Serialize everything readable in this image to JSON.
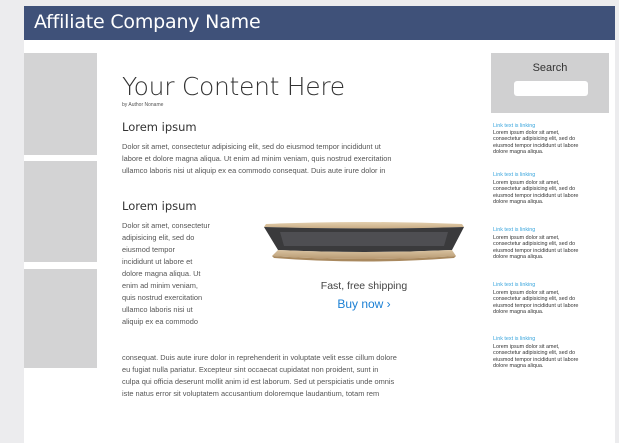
{
  "header": {
    "title": "Affiliate Company Name"
  },
  "article": {
    "title": "Your Content Here",
    "byline": "by Author Noname",
    "section1_heading": "Lorem ipsum",
    "section1_lines": [
      "Dolor sit amet, consectetur adipisicing elit, sed do eiusmod tempor incididunt ut",
      "labore et dolore magna aliqua. Ut enim ad minim veniam, quis nostrud exercitation",
      "ullamco laboris nisi ut aliquip ex ea commodo consequat. Duis aute irure dolor in"
    ],
    "section2_heading": "Lorem ipsum",
    "section2_narrow_lines": [
      "Dolor sit amet, consectetur",
      "adipisicing elit, sed do",
      "eiusmod tempor",
      "incididunt ut labore et",
      "dolore magna aliqua. Ut",
      "enim ad minim veniam,",
      "quis nostrud exercitation",
      "ullamco laboris nisi ut",
      "aliquip ex ea commodo"
    ],
    "section2_wide_lines": [
      "consequat. Duis aute irure dolor in reprehenderit in voluptate velit esse cillum dolore",
      "eu fugiat nulla pariatur. Excepteur sint occaecat cupidatat non proident, sunt in",
      "culpa qui officia deserunt mollit anim id est laborum. Sed ut perspiciatis unde omnis",
      "iste natus error sit voluptatem accusantium doloremque laudantium, totam rem"
    ]
  },
  "promo": {
    "shipping_text": "Fast, free shipping",
    "buy_label": "Buy now ›"
  },
  "sidebar": {
    "search_label": "Search",
    "search_value": "",
    "items": [
      {
        "link": "Link text is linking",
        "lines": [
          "Lorem ipsum dolor sit amet,",
          "consectetur adipisicing elit, sed do",
          "eiusmod tempor incididunt ut labore",
          "dolore magna aliqua."
        ]
      },
      {
        "link": "Link text is linking",
        "lines": [
          "Lorem ipsum dolor sit amet,",
          "consectetur adipisicing elit, sed do",
          "eiusmod tempor incididunt ut labore",
          "dolore magna aliqua."
        ]
      },
      {
        "link": "Link text is linking",
        "lines": [
          "Lorem ipsum dolor sit amet,",
          "consectetur adipisicing elit, sed do",
          "eiusmod tempor incididunt ut labore",
          "dolore magna aliqua."
        ]
      },
      {
        "link": "Link text is linking",
        "lines": [
          "Lorem ipsum dolor sit amet,",
          "consectetur adipisicing elit, sed do",
          "eiusmod tempor incididunt ut labore",
          "dolore magna aliqua."
        ]
      },
      {
        "link": "Link text is linking",
        "lines": [
          "Lorem ipsum dolor sit amet,",
          "consectetur adipisicing elit, sed do",
          "eiusmod tempor incididunt ut labore",
          "dolore magna aliqua."
        ]
      }
    ]
  },
  "colors": {
    "header_bg": "#3f5179",
    "link": "#3aa6dd",
    "buy_link": "#1a7fd4",
    "placeholder_gray": "#d3d3d4"
  }
}
